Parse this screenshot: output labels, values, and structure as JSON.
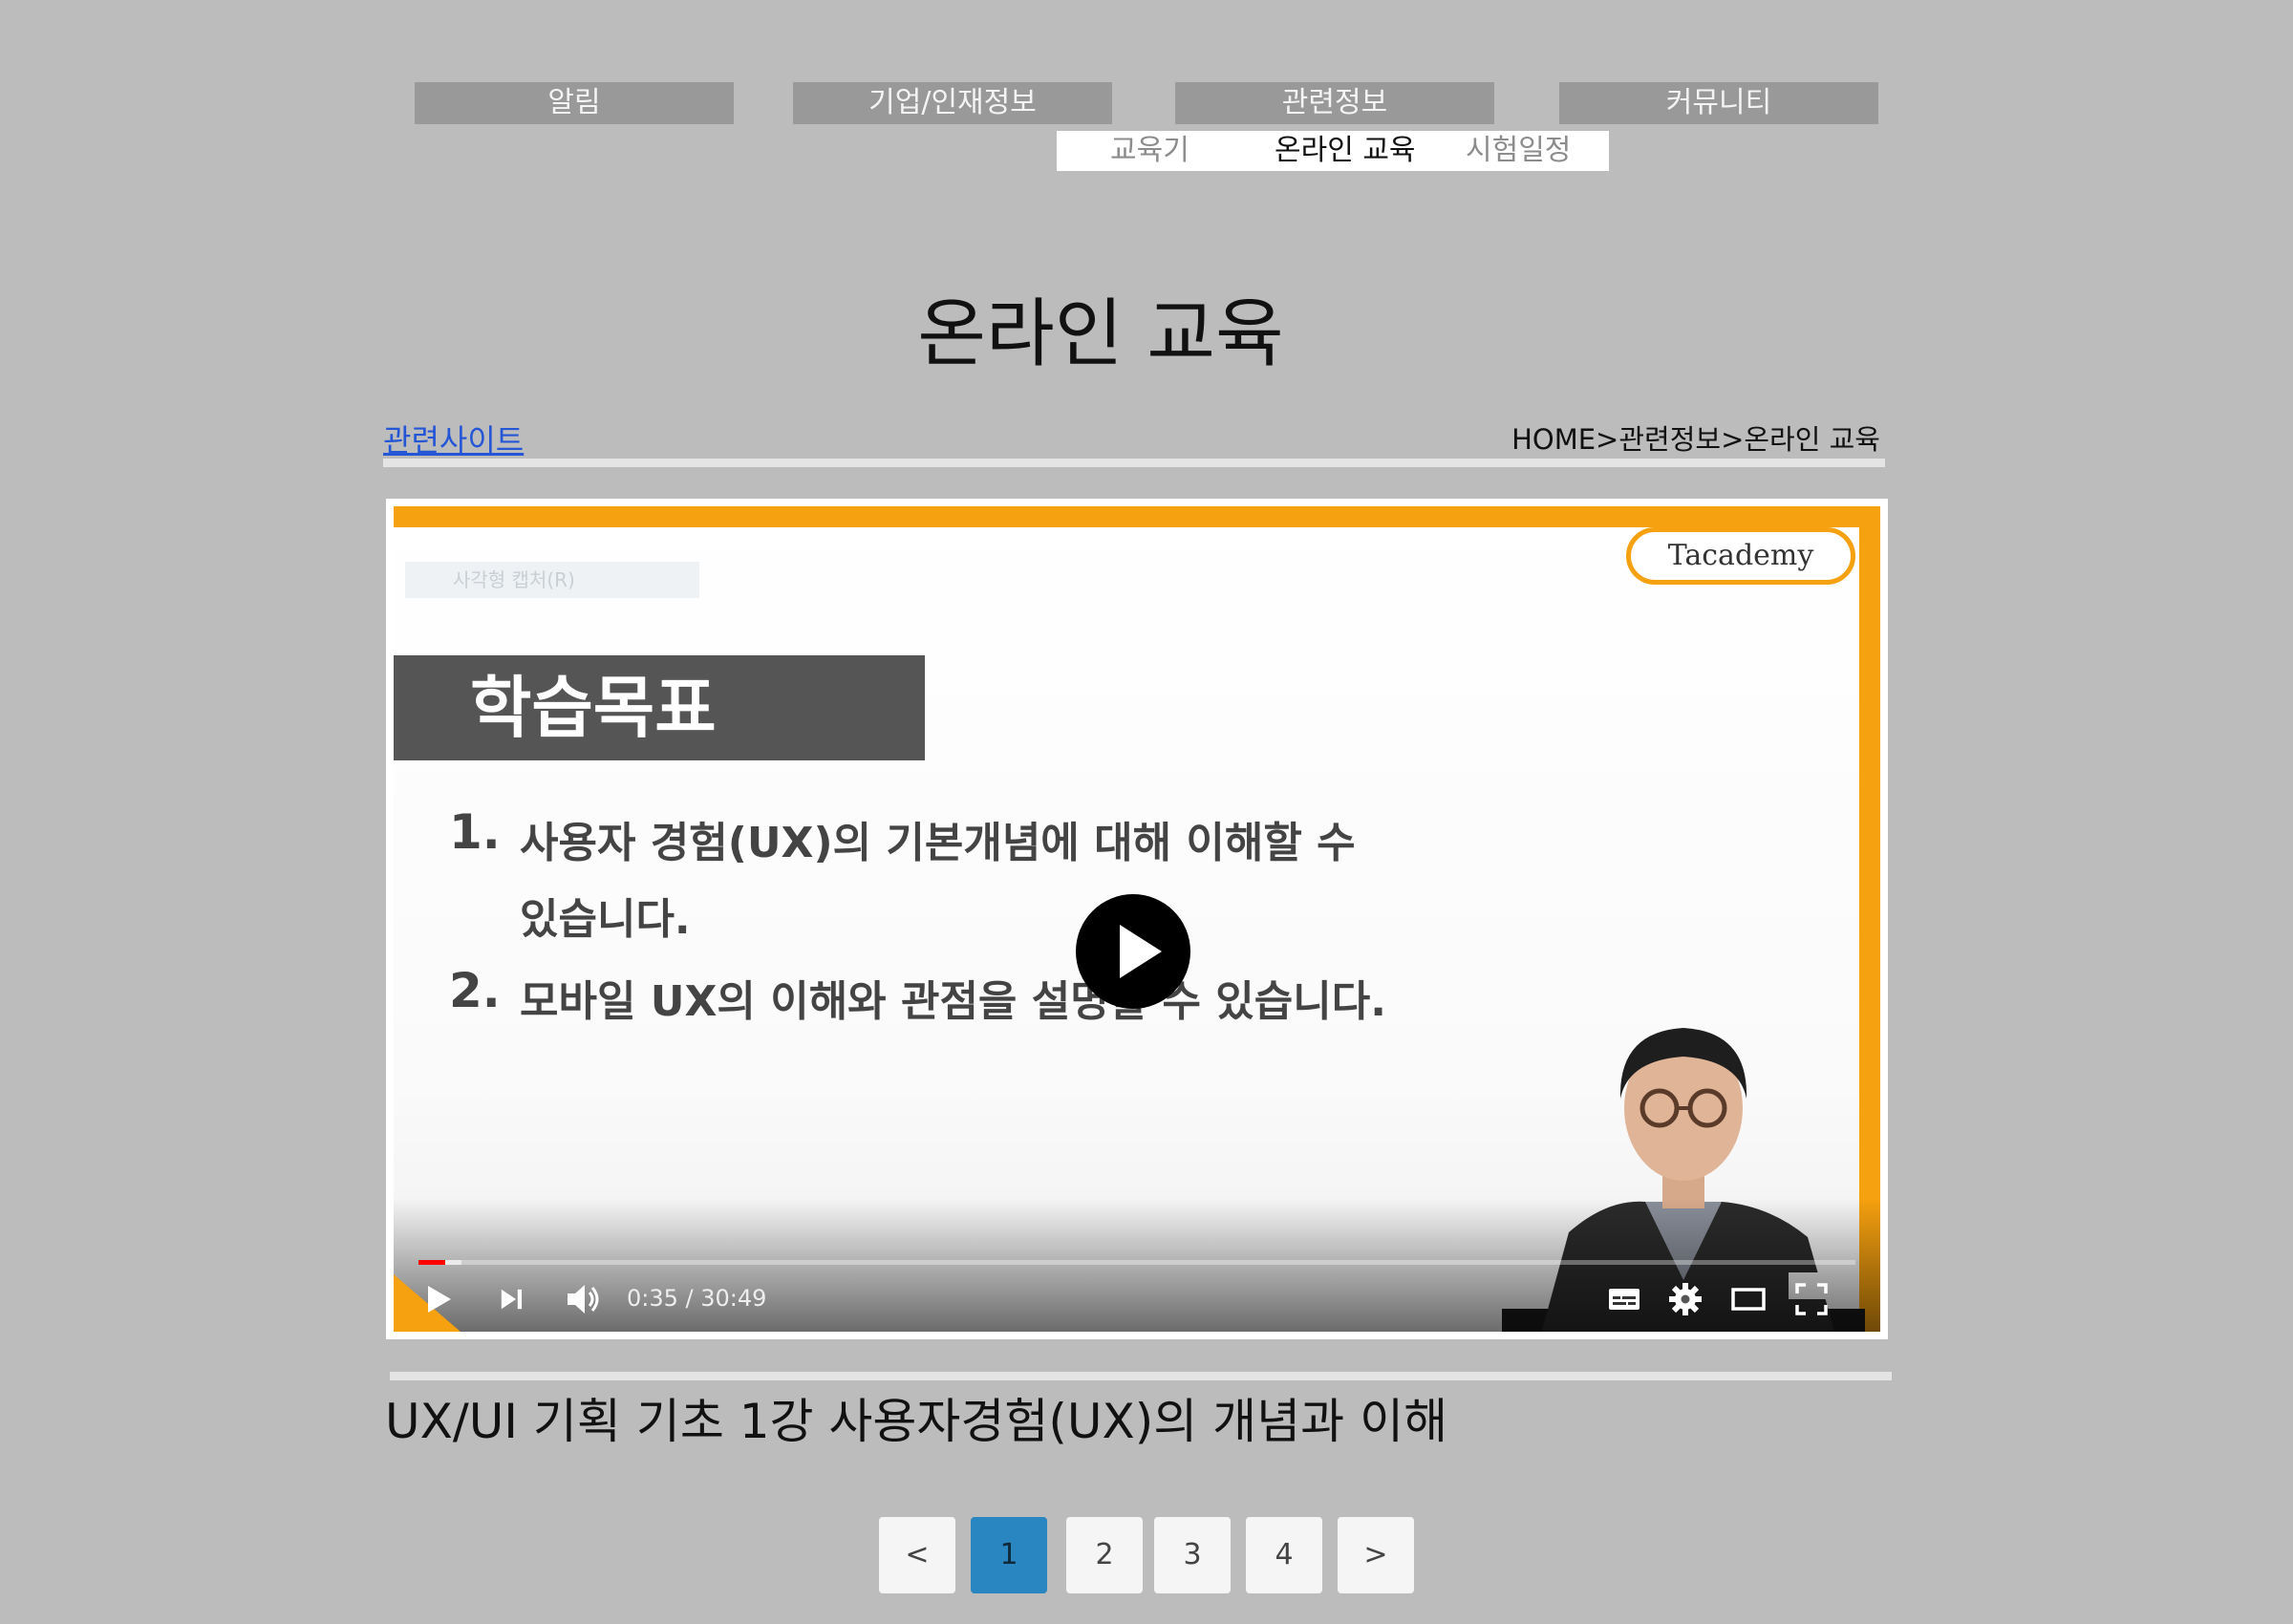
{
  "nav": {
    "items": [
      {
        "label": "알림"
      },
      {
        "label": "기업/인재정보"
      },
      {
        "label": "관련정보"
      },
      {
        "label": "커뮤니티"
      }
    ],
    "submenu": [
      {
        "label": "교육기"
      },
      {
        "label": "온라인 교육"
      },
      {
        "label": "시험일정"
      }
    ]
  },
  "page": {
    "title": "온라인 교육",
    "related_link": "관련사이트",
    "breadcrumb": "HOME>관련정보>온라인 교육"
  },
  "video": {
    "slide": {
      "logo": "Tacademy",
      "faded_chip": "사각형 캡처(R)",
      "heading": "학습목표",
      "goals": [
        {
          "num": "1.",
          "line1": "사용자 경험(UX)의 기본개념에 대해 이해할 수",
          "line2": "있습니다."
        },
        {
          "num": "2.",
          "line1": "모바일 UX의 이해와 관점을 설명할 수 있습니다."
        }
      ]
    },
    "time": "0:35 / 30:49",
    "progress_fraction": 0.0188,
    "title": "UX/UI 기획 기초 1강 사용자경험(UX)의 개념과 이해"
  },
  "pagination": {
    "prev": "<",
    "next": ">",
    "pages": [
      "1",
      "2",
      "3",
      "4"
    ],
    "current": "1"
  },
  "colors": {
    "background": "#bcbcbc",
    "nav_bg": "#999999",
    "link": "#2456d6",
    "accent_orange": "#f6a10f",
    "page_active": "#2a86c0"
  }
}
